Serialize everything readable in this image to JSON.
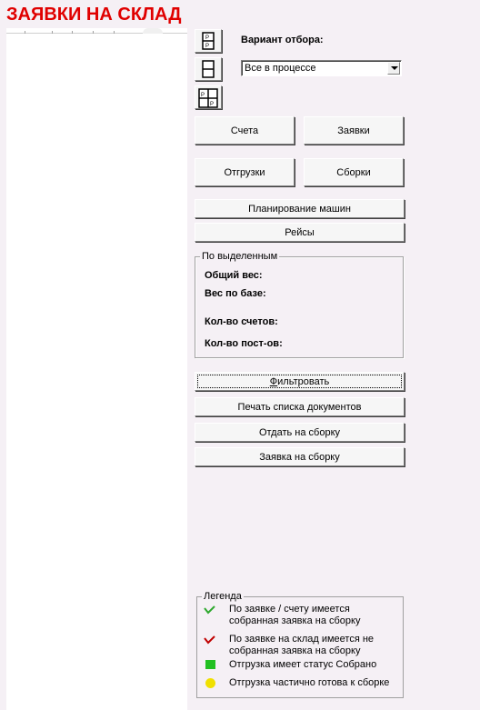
{
  "page_title": "ЗАЯВКИ НА СКЛАД",
  "selection": {
    "label": "Вариант отбора:",
    "value": "Все в процессе"
  },
  "view_buttons": {
    "icons": [
      "split-vertical-icon",
      "single-pane-icon",
      "quad-pane-icon"
    ]
  },
  "buttons": {
    "invoices": "Счета",
    "requests": "Заявки",
    "shipments": "Отгрузки",
    "assemblies": "Сборки",
    "vehicle_planning": "Планирование машин",
    "trips": "Рейсы",
    "filter": "Фильтровать",
    "print_list": "Печать списка документов",
    "send_to_assembly": "Отдать на сборку",
    "request_assembly": "Заявка на сборку"
  },
  "selected_group": {
    "caption": "По выделенным",
    "total_weight": "Общий вес:",
    "base_weight": "Вес по базе:",
    "invoice_count": "Кол-во счетов:",
    "supplier_count": "Кол-во пост-ов:"
  },
  "legend": {
    "caption": "Легенда",
    "items": [
      {
        "icon": "green-check-icon",
        "color": "#2ea82e",
        "line1": "По заявке / счету  имеется",
        "line2": "собранная заявка на сборку"
      },
      {
        "icon": "red-check-icon",
        "color": "#c00000",
        "line1": "По заявке на склад имеется  не",
        "line2": "собранная заявка на сборку"
      },
      {
        "icon": "green-square-icon",
        "color": "#22c022",
        "line1": "Отгрузка имеет статус Собрано"
      },
      {
        "icon": "yellow-dot-icon",
        "color": "#f0e000",
        "line1": "Отгрузка частично готова к сборке"
      }
    ]
  }
}
